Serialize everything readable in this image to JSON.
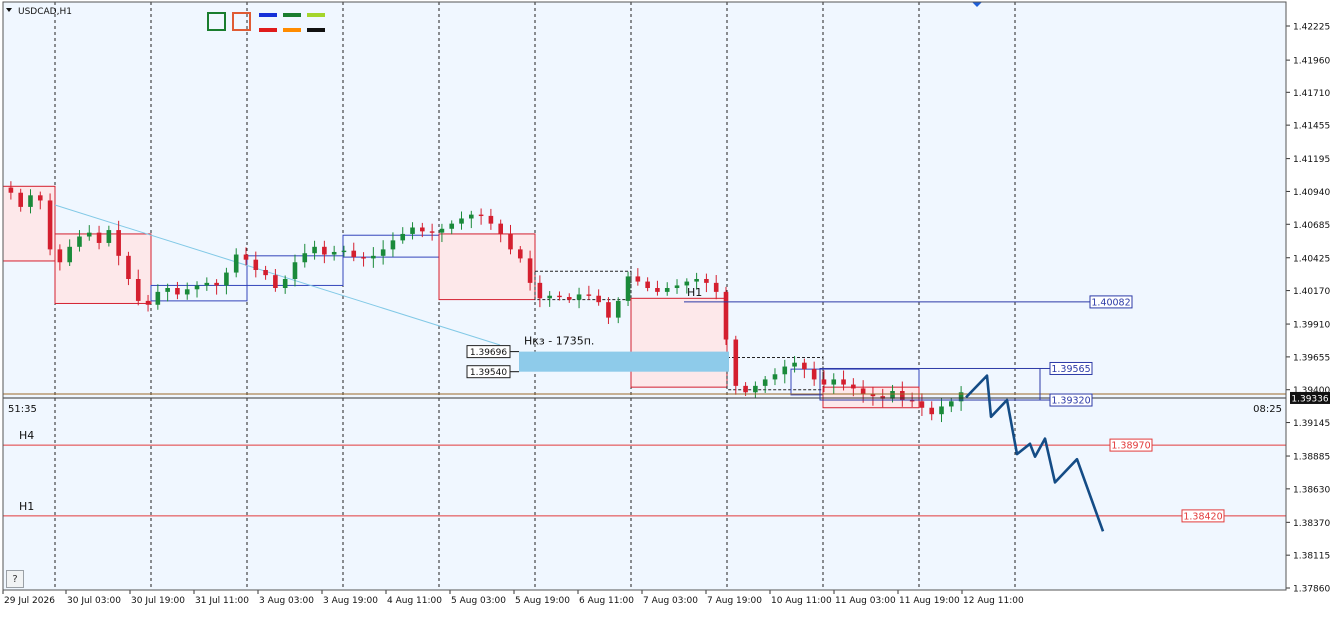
{
  "symbol": "USDCAD,H1",
  "colors": {
    "background": "#f0f7ff",
    "bull_candle": "#1a8a3a",
    "bear_candle": "#d41f2f",
    "price_axis_bg": "#ffffff",
    "bid_line": "#9c6a28",
    "level_red": "#e23b3b",
    "level_blue": "#2c3aa7",
    "projection": "#144c86",
    "zone_fill": "#8ecbea",
    "trendline": "#82c9e6"
  },
  "toolbar": {
    "swatches": [
      "#1a7d2e",
      "#e05b33"
    ],
    "line_colors": [
      "#1530d8",
      "#1a7d2e",
      "#a4d52b",
      "#e01b1b",
      "#ff8c00",
      "#111111"
    ]
  },
  "chart_data": {
    "type": "line",
    "subtype": "candlestick",
    "title": "USDCAD,H1",
    "y_ticks": [
      "1.42225",
      "1.41960",
      "1.41710",
      "1.41455",
      "1.41195",
      "1.40940",
      "1.40685",
      "1.40425",
      "1.40170",
      "1.39910",
      "1.39655",
      "1.39400",
      "1.39145",
      "1.38885",
      "1.38630",
      "1.38370",
      "1.38115",
      "1.37860"
    ],
    "ylim": [
      1.3786,
      1.42225
    ],
    "x_ticks": [
      "29 Jul 2026",
      "30 Jul 03:00",
      "30 Jul 19:00",
      "31 Jul 11:00",
      "3 Aug 03:00",
      "3 Aug 19:00",
      "4 Aug 11:00",
      "5 Aug 03:00",
      "5 Aug 19:00",
      "6 Aug 11:00",
      "7 Aug 03:00",
      "7 Aug 19:00",
      "10 Aug 11:00",
      "11 Aug 03:00",
      "11 Aug 19:00",
      "12 Aug 11:00"
    ],
    "grid": "vertical dashed separators",
    "price_path": [
      1.4097,
      1.4093,
      1.4082,
      1.4091,
      1.4087,
      1.4049,
      1.4039,
      1.4051,
      1.4059,
      1.4062,
      1.4054,
      1.4064,
      1.4044,
      1.4026,
      1.4009,
      1.4006,
      1.4016,
      1.4019,
      1.4014,
      1.4018,
      1.4021,
      1.4023,
      1.4021,
      1.4031,
      1.4045,
      1.4041,
      1.4033,
      1.4029,
      1.4019,
      1.4026,
      1.4039,
      1.4046,
      1.4051,
      1.4045,
      1.4047,
      1.4048,
      1.4043,
      1.4042,
      1.4044,
      1.4049,
      1.4056,
      1.4061,
      1.4066,
      1.4063,
      1.4062,
      1.4065,
      1.4069,
      1.4073,
      1.4076,
      1.4075,
      1.4069,
      1.4061,
      1.4049,
      1.4042,
      1.4023,
      1.4011,
      1.4013,
      1.4012,
      1.401,
      1.4014,
      1.4013,
      1.4008,
      1.3996,
      1.4009,
      1.4028,
      1.4024,
      1.4019,
      1.4016,
      1.4019,
      1.4021,
      1.4024,
      1.4026,
      1.4023,
      1.4016,
      1.3979,
      1.3943,
      1.3938,
      1.3943,
      1.3948,
      1.3952,
      1.3958,
      1.3961,
      1.3956,
      1.3948,
      1.3944,
      1.3948,
      1.3944,
      1.3941,
      1.3937,
      1.3935,
      1.3933,
      1.3939,
      1.3932,
      1.3931,
      1.3926,
      1.3921,
      1.3927,
      1.3931,
      1.3938
    ],
    "current_price": "1.39336",
    "levels": [
      {
        "label": "H4",
        "price": "1.38970",
        "color": "#e23b3b"
      },
      {
        "label": "H1",
        "price": "1.38420",
        "color": "#e23b3b"
      },
      {
        "label": "H1",
        "price": "1.40082",
        "color": "#2c3aa7"
      }
    ],
    "box_labels": [
      "1.39565",
      "1.39320"
    ],
    "zone": {
      "label": "Нкз - 1735п.",
      "top": "1.39696",
      "bottom": "1.39540"
    },
    "projection": [
      1.3934,
      1.3951,
      1.3919,
      1.3932,
      1.389,
      1.3898,
      1.3888,
      1.3902,
      1.3868,
      1.3886,
      1.383
    ],
    "timers": {
      "left": "51:35",
      "right": "08:25"
    }
  },
  "help_label": "?"
}
